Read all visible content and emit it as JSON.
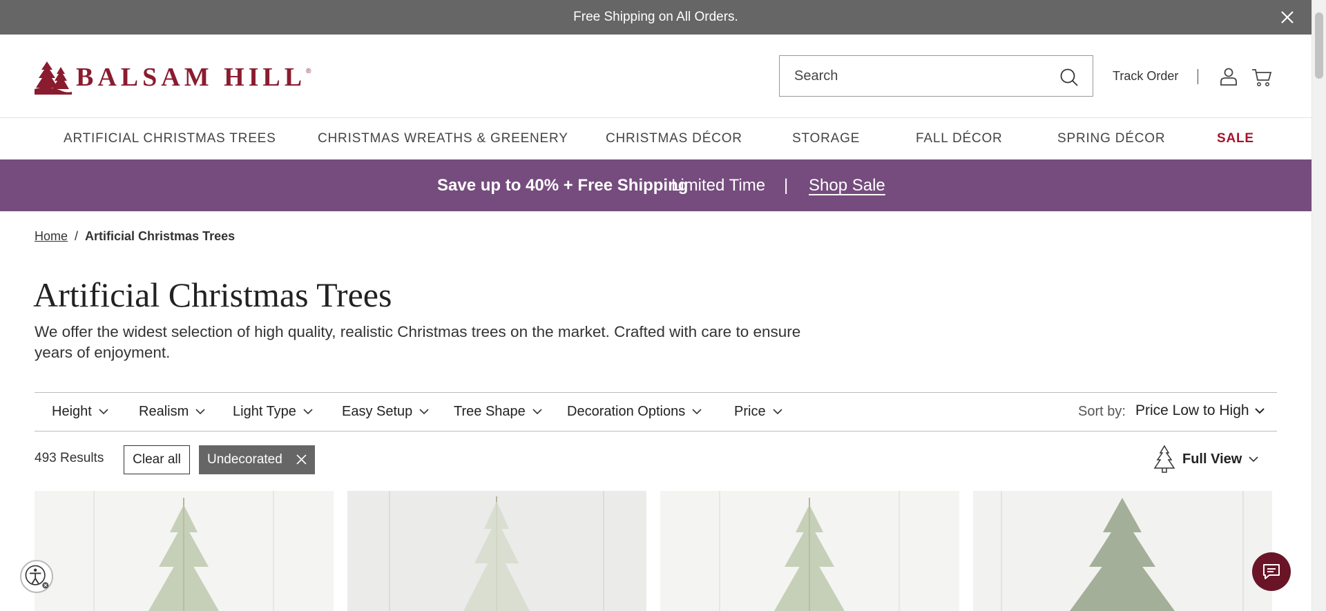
{
  "announcement": {
    "text": "Free Shipping on All Orders."
  },
  "header": {
    "logo_text": "BALSAM HILL",
    "logo_mark": "®",
    "search_placeholder": "Search",
    "track_order": "Track Order"
  },
  "nav": {
    "items": [
      {
        "label": "ARTIFICIAL CHRISTMAS TREES"
      },
      {
        "label": "CHRISTMAS WREATHS & GREENERY"
      },
      {
        "label": "CHRISTMAS DÉCOR"
      },
      {
        "label": "STORAGE"
      },
      {
        "label": "FALL DÉCOR"
      },
      {
        "label": "SPRING DÉCOR"
      },
      {
        "label": "SALE"
      }
    ]
  },
  "promo": {
    "headline": "Save up to 40% + Free Shipping",
    "limited": "Limited Time",
    "separator": "|",
    "link": "Shop Sale"
  },
  "breadcrumb": {
    "home": "Home",
    "separator": "/",
    "current": "Artificial Christmas Trees"
  },
  "page": {
    "title": "Artificial Christmas Trees",
    "description": "We offer the widest selection of high quality, realistic Christmas trees on the market. Crafted with care to ensure years of enjoyment."
  },
  "filters": {
    "items": [
      {
        "label": "Height"
      },
      {
        "label": "Realism"
      },
      {
        "label": "Light Type"
      },
      {
        "label": "Easy Setup"
      },
      {
        "label": "Tree Shape"
      },
      {
        "label": "Decoration Options"
      },
      {
        "label": "Price"
      }
    ],
    "sort_label": "Sort by:",
    "sort_value": "Price Low to High"
  },
  "results": {
    "count": "493 Results",
    "clear_all": "Clear all",
    "active_filter": "Undecorated",
    "view_label": "Full View"
  },
  "icons": {
    "close": "close-icon",
    "search": "search-icon",
    "user": "user-icon",
    "cart": "cart-icon",
    "chevron": "chevron-down-icon",
    "tree": "tree-icon",
    "accessibility": "accessibility-icon",
    "chat": "chat-icon"
  },
  "colors": {
    "announcement_bg": "#666666",
    "promo_bg": "#754c7d",
    "brand": "#8a1c2f",
    "sale": "#a3162c",
    "chip_bg": "#666666",
    "chat_bg": "#6a1527"
  }
}
